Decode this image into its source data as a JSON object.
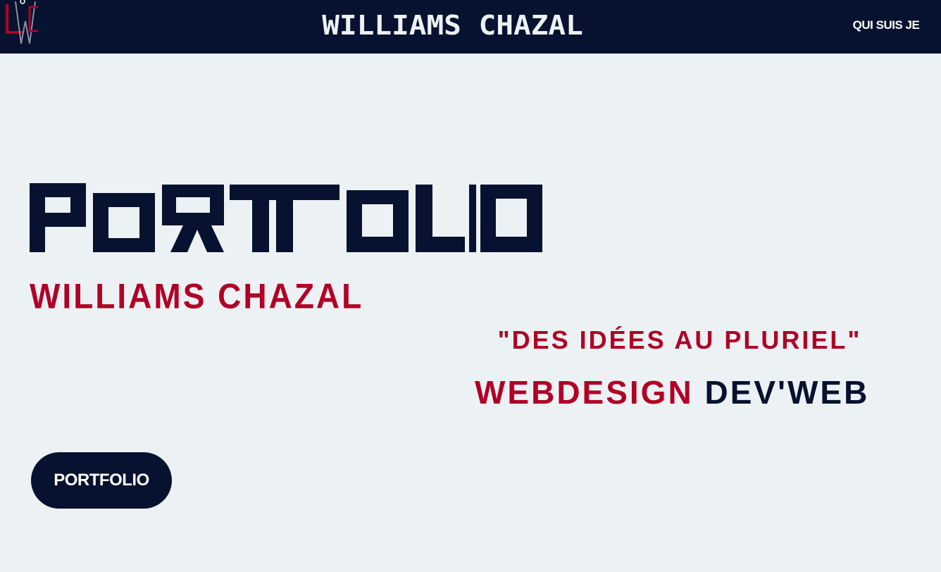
{
  "header": {
    "title": "WILLIAMS CHAZAL",
    "nav": [
      {
        "label": "QUI SUIS JE"
      }
    ],
    "logo": {
      "icon": "wc-monogram-logo",
      "text": "WC"
    }
  },
  "hero": {
    "big_word": "PORTFOLIO",
    "name": "WILLIAMS CHAZAL",
    "tagline": "\"DES IDÉES AU PLURIEL\"",
    "skill_a": "WEBDESIGN",
    "skill_b": "DEV'WEB",
    "button_label": "PORTFOLIO"
  },
  "colors": {
    "navy": "#06122F",
    "crimson": "#B00026",
    "background": "#ECF1F4"
  }
}
